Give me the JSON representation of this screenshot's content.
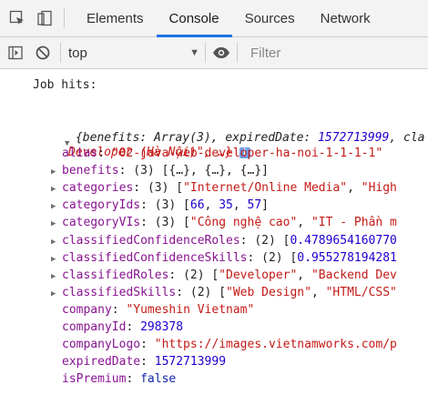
{
  "tabs": [
    "Elements",
    "Console",
    "Sources",
    "Network"
  ],
  "active_tab": "Console",
  "toolbar": {
    "context": "top",
    "filter_placeholder": "Filter"
  },
  "console": {
    "log_message": "Job hits:",
    "object_preview_line1_a": "{benefits: Array(3), expiredDate: ",
    "object_preview_line1_num": "1572713999",
    "object_preview_line1_b": ", cla",
    "object_preview_line2": "Developer (Hà Nội)\", …}",
    "entries": [
      {
        "key": "alias",
        "sep": ": ",
        "value": "\"02-java-web-developer-ha-noi-1-1-1-1\"",
        "kind": "str",
        "expandable": false
      },
      {
        "key": "benefits",
        "sep": ": ",
        "value": "(3) [{…}, {…}, {…}]",
        "kind": "plain",
        "expandable": true
      },
      {
        "key": "categories",
        "sep": ": ",
        "value": "(3) [\"Internet/Online Media\", \"High",
        "kind": "strarr",
        "expandable": true
      },
      {
        "key": "categoryIds",
        "sep": ": ",
        "value": "(3) [66, 35, 57]",
        "kind": "numarr",
        "expandable": true
      },
      {
        "key": "categoryVIs",
        "sep": ": ",
        "value": "(3) [\"Công nghệ cao\", \"IT - Phần m",
        "kind": "strarr",
        "expandable": true
      },
      {
        "key": "classifiedConfidenceRoles",
        "sep": ": ",
        "value": "(2) [0.4789654160770",
        "kind": "numarr",
        "expandable": true
      },
      {
        "key": "classifiedConfidenceSkills",
        "sep": ": ",
        "value": "(2) [0.955278194281",
        "kind": "numarr",
        "expandable": true
      },
      {
        "key": "classifiedRoles",
        "sep": ": ",
        "value": "(2) [\"Developer\", \"Backend Dev",
        "kind": "strarr",
        "expandable": true
      },
      {
        "key": "classifiedSkills",
        "sep": ": ",
        "value": "(2) [\"Web Design\", \"HTML/CSS\"",
        "kind": "strarr",
        "expandable": true
      },
      {
        "key": "company",
        "sep": ": ",
        "value": "\"Yumeshin Vietnam\"",
        "kind": "str",
        "expandable": false
      },
      {
        "key": "companyId",
        "sep": ": ",
        "value": "298378",
        "kind": "num",
        "expandable": false
      },
      {
        "key": "companyLogo",
        "sep": ": ",
        "value": "\"https://images.vietnamworks.com/p",
        "kind": "str",
        "expandable": false
      },
      {
        "key": "expiredDate",
        "sep": ": ",
        "value": "1572713999",
        "kind": "num",
        "expandable": false
      },
      {
        "key": "isPremium",
        "sep": ": ",
        "value": "false",
        "kind": "bool",
        "expandable": false
      }
    ]
  },
  "colors": {
    "accent": "#1a73e8",
    "prop_key": "#881391",
    "string": "#c41a16",
    "number": "#1c00cf"
  },
  "icons": [
    "inspect-element-icon",
    "device-toggle-icon",
    "sidebar-toggle-icon",
    "clear-console-icon",
    "eye-icon",
    "info-icon"
  ]
}
